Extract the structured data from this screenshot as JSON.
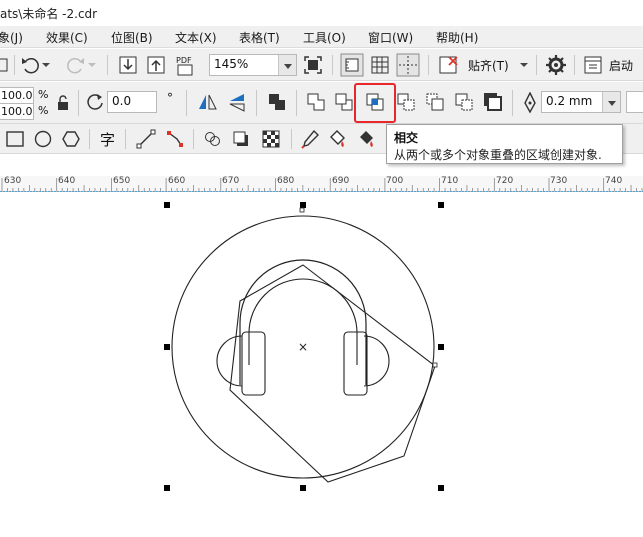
{
  "window": {
    "title": "ats\\未命名 -2.cdr"
  },
  "menu": [
    "象(J)",
    "效果(C)",
    "位图(B)",
    "文本(X)",
    "表格(T)",
    "工具(O)",
    "窗口(W)",
    "帮助(H)"
  ],
  "toolbar1": {
    "zoom_value": "145%",
    "snap_label": "贴齐(T)",
    "launch_label": "启动",
    "pdf_label": "PDF"
  },
  "property_bar": {
    "scale_x": "100.0",
    "scale_y": "100.0",
    "percent_symbol": "%",
    "rotation_value": "0.0",
    "rotation_unit": "°",
    "outline_width": "0.2 mm",
    "intersect_button": {
      "state": "highlighted",
      "highlight_color": "#e8262b"
    }
  },
  "toolbox": {
    "text_tool_glyph": "字"
  },
  "tooltip": {
    "title": "相交",
    "description": "从两个或多个对象重叠的区域创建对象."
  },
  "ruler": {
    "ticks": [
      "630",
      "640",
      "650",
      "660",
      "670",
      "680",
      "690",
      "700",
      "710",
      "720",
      "730",
      "740"
    ]
  },
  "canvas": {
    "center_marker": "×"
  },
  "colors": {
    "accent_blue": "#1e6fc0",
    "highlight_red": "#e8262b",
    "fill_red": "#d9362b"
  }
}
